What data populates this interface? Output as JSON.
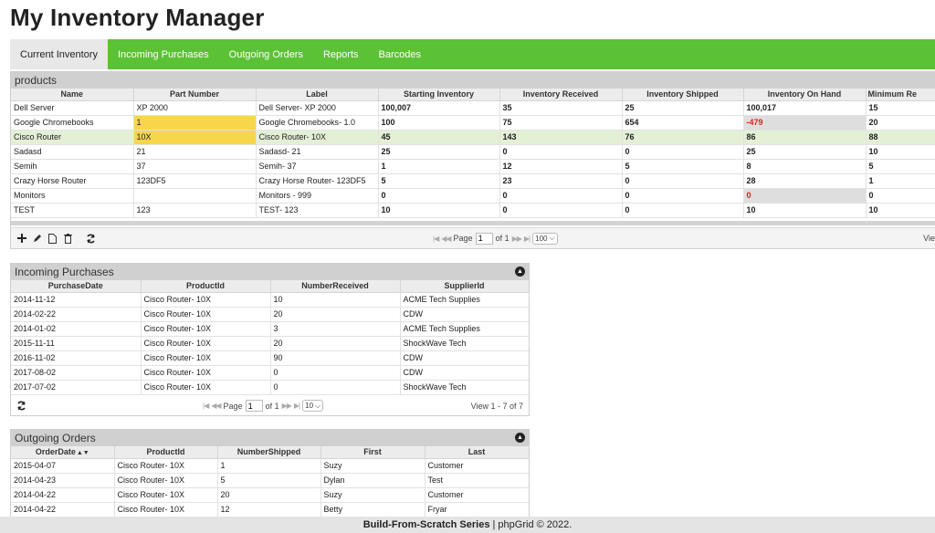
{
  "app": {
    "title": "My Inventory Manager"
  },
  "nav": {
    "tabs": [
      {
        "label": "Current Inventory"
      },
      {
        "label": "Incoming Purchases"
      },
      {
        "label": "Outgoing Orders"
      },
      {
        "label": "Reports"
      },
      {
        "label": "Barcodes"
      }
    ]
  },
  "products": {
    "title": "products",
    "columns": [
      "Name",
      "Part Number",
      "Label",
      "Starting Inventory",
      "Inventory Received",
      "Inventory Shipped",
      "Inventory On Hand",
      "Minimum Re"
    ],
    "rows": [
      [
        "Dell Server",
        "XP 2000",
        "Dell Server- XP 2000",
        "100,007",
        "35",
        "25",
        "100,017",
        "15"
      ],
      [
        "Google Chromebooks",
        "1",
        "Google Chromebooks- 1.0",
        "100",
        "75",
        "654",
        "-479",
        "20"
      ],
      [
        "Cisco Router",
        "10X",
        "Cisco Router- 10X",
        "45",
        "143",
        "76",
        "86",
        "88"
      ],
      [
        "Sadasd",
        "21",
        "Sadasd- 21",
        "25",
        "0",
        "0",
        "25",
        "10"
      ],
      [
        "Semih",
        "37",
        "Semih- 37",
        "1",
        "12",
        "5",
        "8",
        "5"
      ],
      [
        "Crazy Horse Router",
        "123DF5",
        "Crazy Horse Router- 123DF5",
        "5",
        "23",
        "0",
        "28",
        "1"
      ],
      [
        "Monitors",
        "",
        "Monitors - 999",
        "0",
        "0",
        "0",
        "0",
        "0"
      ],
      [
        "TEST",
        "123",
        "TEST- 123",
        "10",
        "0",
        "0",
        "10",
        "10"
      ]
    ],
    "pager": {
      "page_label": "Page",
      "page_value": "1",
      "of_label": "of 1",
      "page_size": "100",
      "view_text": "Vie"
    }
  },
  "incoming": {
    "title": "Incoming Purchases",
    "columns": [
      "PurchaseDate",
      "ProductId",
      "NumberReceived",
      "SupplierId"
    ],
    "rows": [
      [
        "2014-11-12",
        "Cisco Router- 10X",
        "10",
        "ACME Tech Supplies"
      ],
      [
        "2014-02-22",
        "Cisco Router- 10X",
        "20",
        "CDW"
      ],
      [
        "2014-01-02",
        "Cisco Router- 10X",
        "3",
        "ACME Tech Supplies"
      ],
      [
        "2015-11-11",
        "Cisco Router- 10X",
        "20",
        "ShockWave Tech"
      ],
      [
        "2016-11-02",
        "Cisco Router- 10X",
        "90",
        "CDW"
      ],
      [
        "2017-08-02",
        "Cisco Router- 10X",
        "0",
        "CDW"
      ],
      [
        "2017-07-02",
        "Cisco Router- 10X",
        "0",
        "ShockWave Tech"
      ]
    ],
    "pager": {
      "page_label": "Page",
      "page_value": "1",
      "of_label": "of 1",
      "page_size": "10",
      "view_text": "View 1 - 7 of 7"
    }
  },
  "outgoing": {
    "title": "Outgoing Orders",
    "columns": [
      "OrderDate",
      "ProductId",
      "NumberShipped",
      "First",
      "Last"
    ],
    "rows": [
      [
        "2015-04-07",
        "Cisco Router- 10X",
        "1",
        "Suzy",
        "Customer"
      ],
      [
        "2014-04-23",
        "Cisco Router- 10X",
        "5",
        "Dylan",
        "Test"
      ],
      [
        "2014-04-22",
        "Cisco Router- 10X",
        "20",
        "Suzy",
        "Customer"
      ],
      [
        "2014-04-22",
        "Cisco Router- 10X",
        "12",
        "Betty",
        "Fryar"
      ]
    ]
  },
  "footer": {
    "series": "Build-From-Scratch Series",
    "credit": " | phpGrid © 2022."
  },
  "colors": {
    "nav_green": "#5cc235",
    "highlight_yellow": "#f8d649",
    "negative_red": "#e0201b",
    "selected_row": "#e3f0d6"
  }
}
